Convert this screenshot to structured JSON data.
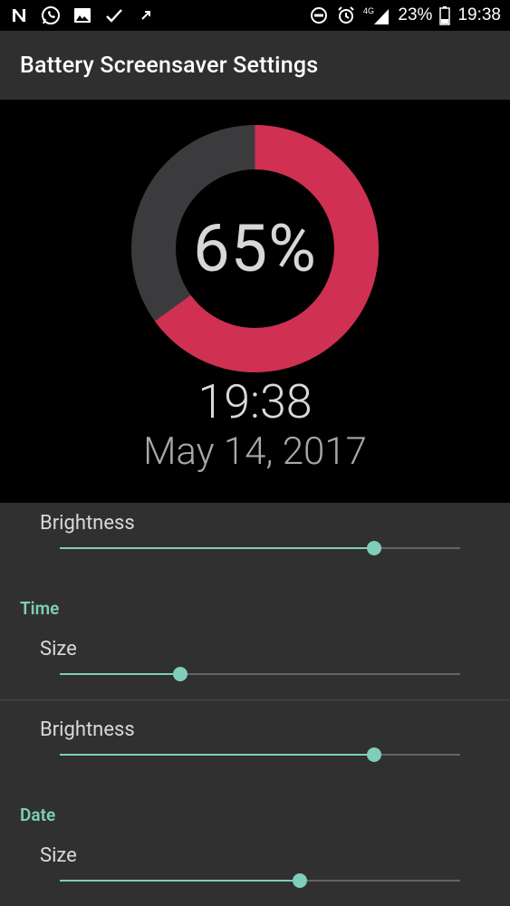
{
  "status_bar": {
    "left_icons": [
      "notification-n-icon",
      "whatsapp-icon",
      "image-icon",
      "check-icon",
      "arrow-icon"
    ],
    "network": "4G",
    "battery": "23%",
    "time": "19:38"
  },
  "app_bar": {
    "title": "Battery Screensaver Settings"
  },
  "preview": {
    "battery_percent_text": "65%",
    "battery_level": 0.65,
    "time": "19:38",
    "date": "May 14, 2017",
    "colors": {
      "arc": "#d03052",
      "track": "#3b3b3d",
      "background": "#000000"
    }
  },
  "settings": {
    "battery": {
      "brightness_label": "Brightness",
      "brightness_value": 0.785
    },
    "time": {
      "header": "Time",
      "size_label": "Size",
      "size_value": 0.3,
      "brightness_label": "Brightness",
      "brightness_value": 0.785
    },
    "date": {
      "header": "Date",
      "size_label": "Size",
      "size_value": 0.6
    },
    "accent_color": "#7fcdbb"
  }
}
